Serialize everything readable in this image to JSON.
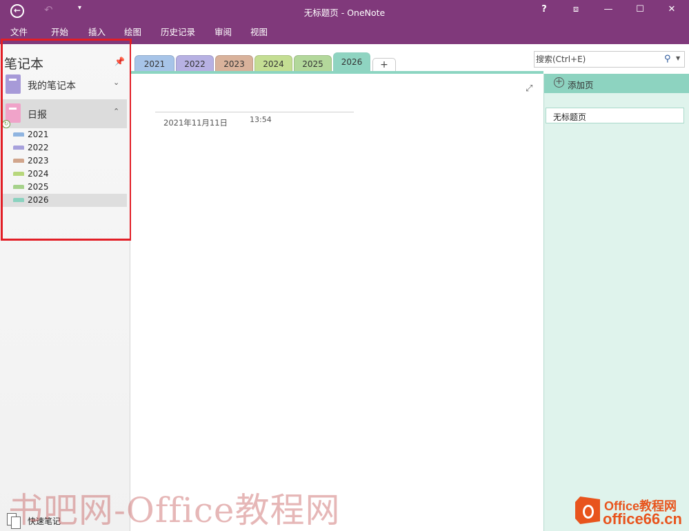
{
  "window": {
    "title": "无标题页 - OneNote",
    "back_glyph": "←",
    "undo_glyph": "↶",
    "qat_glyph": "▾",
    "help": "?",
    "restore_ribbon": "⧈",
    "minimize": "—",
    "maximize": "☐",
    "close": "✕"
  },
  "ribbon": {
    "tabs": [
      "文件",
      "开始",
      "插入",
      "绘图",
      "历史记录",
      "审阅",
      "视图"
    ]
  },
  "notebook_pane": {
    "title": "笔记本",
    "pin_glyph": "📌",
    "notebooks": [
      {
        "label": "我的笔记本",
        "color": "#a79ad8",
        "chevron": "⌄",
        "selected": false
      },
      {
        "label": "日报",
        "color": "#f0a3c9",
        "chevron": "⌃",
        "selected": true
      }
    ],
    "sync_glyph": "↻",
    "sections": [
      {
        "label": "2021",
        "color": "#8fb4e0"
      },
      {
        "label": "2022",
        "color": "#a7a1dc"
      },
      {
        "label": "2023",
        "color": "#d1a58c"
      },
      {
        "label": "2024",
        "color": "#b7d77c"
      },
      {
        "label": "2025",
        "color": "#a6d28b"
      },
      {
        "label": "2026",
        "color": "#8ad2bf",
        "selected": true
      }
    ],
    "quick_notes": "快速笔记"
  },
  "section_tabs": [
    {
      "label": "2021",
      "color": "#a7c4e8"
    },
    {
      "label": "2022",
      "color": "#b7b1e3"
    },
    {
      "label": "2023",
      "color": "#d9b29b"
    },
    {
      "label": "2024",
      "color": "#c4de93"
    },
    {
      "label": "2025",
      "color": "#b3d89b"
    },
    {
      "label": "2026",
      "color": "#8fd4c1",
      "active": true
    }
  ],
  "add_section_glyph": "+",
  "search": {
    "placeholder": "搜索(Ctrl+E)",
    "icon": "search-icon",
    "dropdown_glyph": "▼"
  },
  "page": {
    "expand_glyph": "⤢",
    "date": "2021年11月11日",
    "time": "13:54"
  },
  "page_list": {
    "add_page_label": "添加页",
    "add_page_glyph": "+",
    "pages": [
      "无标题页"
    ]
  },
  "watermark": {
    "text": "书吧网-Office教程网",
    "logo_line1": "Office教程网",
    "logo_line2": "office66.cn"
  },
  "colors": {
    "brand_purple": "#80397b",
    "active_section": "#8fd4c1",
    "highlight_red": "#e21e26"
  }
}
